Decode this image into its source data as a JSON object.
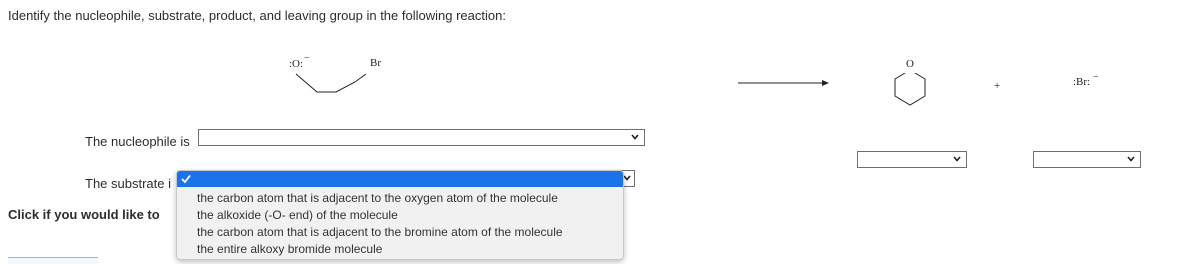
{
  "question": "Identify the nucleophile, substrate, product, and leaving group in the following reaction:",
  "reactant": {
    "oxygen_label": ":O:",
    "oxygen_charge": "−",
    "bromine_label": "Br"
  },
  "product": {
    "ring_oxygen_label": "O",
    "plus": "+",
    "bromide_label": ":Br:",
    "bromide_charge": "−"
  },
  "rows": {
    "nucleophile_label": "The nucleophile is",
    "substrate_label": "The substrate i",
    "link_prompt": "Click if you would like to"
  },
  "dropdown": {
    "options": [
      "",
      "the carbon atom that is adjacent to the oxygen atom of the molecule",
      "the alkoxide (-O- end) of the molecule",
      "the carbon atom that is adjacent to the bromine atom of the molecule",
      "the entire alkoxy bromide molecule"
    ]
  },
  "colors": {
    "highlight": "#1a73e8",
    "text": "#2d2d2d",
    "border": "#6f6f6f"
  }
}
